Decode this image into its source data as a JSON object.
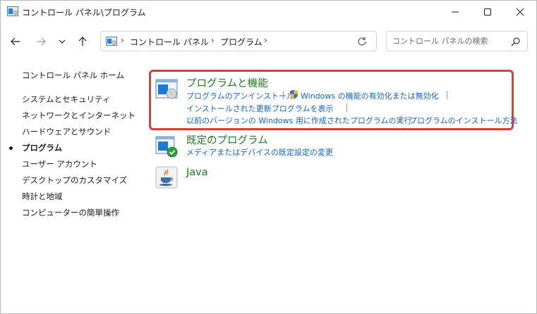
{
  "window": {
    "title": "コントロール パネル\\プログラム",
    "minimize_label": "minimize",
    "maximize_label": "maximize",
    "close_label": "close"
  },
  "address": {
    "crumbs": [
      "コントロール パネル",
      "プログラム"
    ]
  },
  "search": {
    "placeholder": "コントロール パネルの検索",
    "value": ""
  },
  "sidebar": {
    "home": "コントロール パネル ホーム",
    "items": [
      {
        "label": "システムとセキュリティ",
        "active": false
      },
      {
        "label": "ネットワークとインターネット",
        "active": false
      },
      {
        "label": "ハードウェアとサウンド",
        "active": false
      },
      {
        "label": "プログラム",
        "active": true
      },
      {
        "label": "ユーザー アカウント",
        "active": false
      },
      {
        "label": "デスクトップのカスタマイズ",
        "active": false
      },
      {
        "label": "時計と地域",
        "active": false
      },
      {
        "label": "コンピューターの簡単操作",
        "active": false
      }
    ]
  },
  "categories": {
    "programs_features": {
      "title": "プログラムと機能",
      "links": {
        "uninstall": "プログラムのアンインストール",
        "windows_features": "Windows の機能の有効化または無効化",
        "installed_updates": "インストールされた更新プログラムを表示",
        "compat": "以前のバージョンの Windows 用に作成されたプログラムの実行",
        "how_to_install": "プログラムのインストール方法"
      }
    },
    "default_programs": {
      "title": "既定のプログラム",
      "links": {
        "defaults": "メディアまたはデバイスの既定設定の変更"
      }
    },
    "java": {
      "title": "Java"
    }
  },
  "colors": {
    "link": "#1565c0",
    "category_title": "#1f7a1f",
    "highlight": "#e53935"
  }
}
